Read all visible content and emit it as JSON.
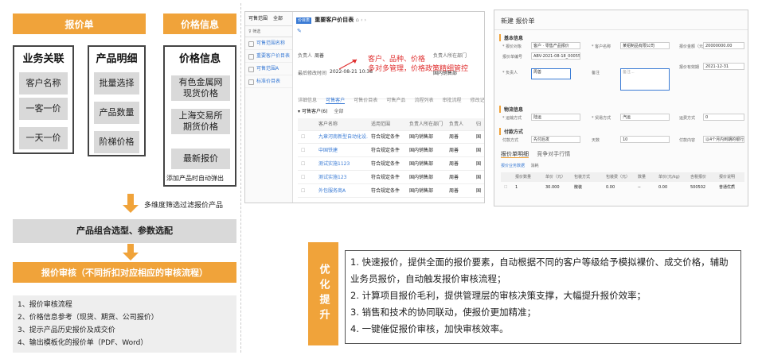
{
  "left": {
    "header_quote": "报价单",
    "header_price": "价格信息",
    "col1": {
      "title": "业务关联",
      "items": [
        "客户名称",
        "一客一价",
        "一天一价"
      ]
    },
    "col2": {
      "title": "产品明细",
      "items": [
        "批量选择",
        "产品数量",
        "阶梯价格"
      ]
    },
    "col3": {
      "title": "价格信息",
      "items": [
        "有色金属网\n现货价格",
        "上海交易所\n期货价格",
        "最新报价"
      ],
      "note": "添加产品时自动弹出"
    },
    "filter_note": "多维度筛选过滤报价产品",
    "combo_bar": "产品组合选型、参数选配",
    "review_bar": "报价审核（不同折扣对应相应的审核流程）",
    "list": [
      "1、报价审核流程",
      "2、价格信息参考（现货、期货、公司报价）",
      "3、提示产品历史报价及成交价",
      "4、输出模板化的报价单（PDF、Word）"
    ]
  },
  "mid": {
    "side_tabs": [
      "可售范围",
      "全部"
    ],
    "side_filter": "筛选",
    "side_items": [
      "可售范围名称",
      "重要客户价目表",
      "可售范围A",
      "标准价目表"
    ],
    "badge": "价目表",
    "title": "重要客户价目表",
    "annot_line1": "客户、品种、价格",
    "annot_line2": "多对多管理，价格政策精细管控",
    "owner_label": "负责人",
    "owner_val": "周善",
    "dept_label": "负责人所在部门",
    "dept_val": "国内销售部",
    "modified_label": "最后修改时间",
    "modified_val": "2022-08-21 10:38",
    "tabs": [
      "详细信息",
      "可售客户",
      "可售价目表",
      "可售产品",
      "流程列表",
      "审批流程",
      "修改记录"
    ],
    "active_tab": "可售客户",
    "sub_label": "可售客户(6)",
    "sub_filter": "全部",
    "columns": [
      "客户名称",
      "适用范围",
      "负责人所在部门",
      "负责人",
      "归"
    ],
    "rows": [
      [
        "九章河南新型自动化设…",
        "符合规定条件",
        "国内销售部",
        "周善",
        "国"
      ],
      [
        "中国铁建",
        "符合规定条件",
        "国内销售部",
        "周善",
        "国"
      ],
      [
        "测试实施1123",
        "符合规定条件",
        "国内销售部",
        "周善",
        "国"
      ],
      [
        "测试实施123",
        "符合规定条件",
        "国内销售部",
        "周善",
        "国"
      ],
      [
        "外包服务商A",
        "符合规定条件",
        "国内销售部",
        "周善",
        "国"
      ]
    ]
  },
  "right": {
    "title": "新建 报价单",
    "sec_basic": "基本信息",
    "fields": [
      {
        "label": "* 报价对象",
        "value": "客户 · 零售产品报价"
      },
      {
        "label": "* 客户名称",
        "value": "某铝制品有限公司"
      },
      {
        "label": "报价金额（元）",
        "value": "20000000.00"
      },
      {
        "label": "报价单编号",
        "value": "ABV-2021-08-18_000557"
      },
      {
        "label": "报价有效期",
        "value": "2021-12-31"
      },
      {
        "label": "* 负责人",
        "value": "周善"
      },
      {
        "label": "备注",
        "value": "备注..."
      }
    ],
    "sec_logistics": "物流信息",
    "logistics": [
      {
        "label": "* 运输方式",
        "value": "陆运"
      },
      {
        "label": "* 贸易方式",
        "value": "汽运"
      },
      {
        "label": "运费方式",
        "value": "0"
      }
    ],
    "sec_pay": "付款方式",
    "pay": [
      {
        "label": "付款方式",
        "value": "先付后发"
      },
      {
        "label": "天数",
        "value": "10"
      },
      {
        "label": "付款内容",
        "value": "以4个月内到期的银行承兑汇票"
      }
    ],
    "tabs": [
      "报价单明细",
      "竞争对手行情"
    ],
    "detail_tabs": [
      "报价业务数据",
      "消耗"
    ],
    "detail_cols": [
      "报价数量",
      "单价（元）",
      "包装方式",
      "包装费（元）",
      "数量",
      "单价(元/kg)",
      "含税报价",
      "报价说明"
    ],
    "detail_row": [
      "1",
      "30.000",
      "散装",
      "0.00",
      "--",
      "0.00",
      "500502",
      "普通优质"
    ]
  },
  "opt": {
    "side": "优化提升",
    "lines": [
      "1. 快速报价，提供全面的报价要素，自动根据不同的客户等级给予模拟裸价、成交价格，辅助业务员报价，自动触发报价审核流程；",
      "2. 计算项目报价毛利，提供管理层的审核决策支撑，大幅提升报价效率；",
      "3. 销售和技术的协同联动，使报价更加精准；",
      "4. 一键催促报价审核，加快审核效率。"
    ]
  },
  "colors": {
    "accent": "#f0a33a",
    "blue": "#3a7bd5",
    "grey": "#d9d9d9",
    "annot": "#e03030"
  }
}
